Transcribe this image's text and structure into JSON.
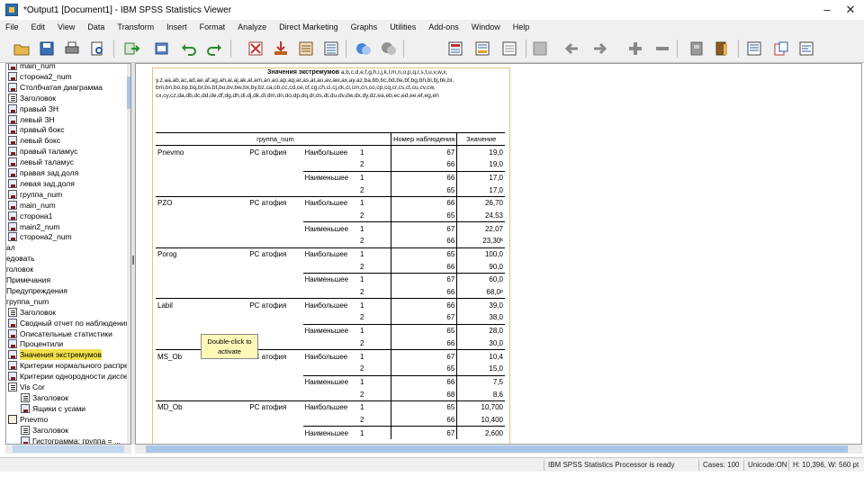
{
  "window": {
    "title": "*Output1 [Document1] - IBM SPSS Statistics Viewer",
    "minimize": "–",
    "close": "✕"
  },
  "menu": [
    "File",
    "Edit",
    "View",
    "Data",
    "Transform",
    "Insert",
    "Format",
    "Analyze",
    "Direct Marketing",
    "Graphs",
    "Utilities",
    "Add-ons",
    "Window",
    "Help"
  ],
  "toolbar_icons": [
    "open-icon",
    "save-icon",
    "print-icon",
    "print-preview-icon",
    "export-icon",
    "recall-dialog-icon",
    "undo-icon",
    "redo-icon",
    "goto-data-icon",
    "goto-case-icon",
    "goto-variable-icon",
    "variables-icon",
    "designate-window-icon",
    "select-last-output-icon",
    "promote-icon",
    "demote-icon",
    "expand-icon",
    "collapse-icon",
    "show-icon",
    "hide-icon",
    "insert-heading-icon",
    "insert-title-icon",
    "insert-text-icon",
    "insert-new-icon"
  ],
  "outline": {
    "rows": [
      {
        "label": "main_num",
        "icon": "table",
        "indent": 1
      },
      {
        "label": "сторона2_num",
        "icon": "table",
        "indent": 1
      },
      {
        "label": "Столбчатая диаграмма",
        "icon": "table",
        "indent": 1
      },
      {
        "label": "Заголовок",
        "icon": "heading",
        "indent": 1
      },
      {
        "label": "правый ЗН",
        "icon": "table",
        "indent": 1
      },
      {
        "label": "левый ЗН",
        "icon": "table",
        "indent": 1
      },
      {
        "label": "правый бокс",
        "icon": "table",
        "indent": 1
      },
      {
        "label": "левый бокс",
        "icon": "table",
        "indent": 1
      },
      {
        "label": "правый таламус",
        "icon": "table",
        "indent": 1
      },
      {
        "label": "левый таламус",
        "icon": "table",
        "indent": 1
      },
      {
        "label": "правая зад.доля",
        "icon": "table",
        "indent": 1
      },
      {
        "label": "левая зад.доля",
        "icon": "table",
        "indent": 1
      },
      {
        "label": "группа_num",
        "icon": "table",
        "indent": 1
      },
      {
        "label": "main_num",
        "icon": "table",
        "indent": 1
      },
      {
        "label": "сторона1",
        "icon": "table",
        "indent": 1
      },
      {
        "label": "main2_num",
        "icon": "table",
        "indent": 1
      },
      {
        "label": "сторона2_num",
        "icon": "table",
        "indent": 1
      },
      {
        "label": "ал",
        "icon": "none",
        "indent": 0
      },
      {
        "label": "едовать",
        "icon": "none",
        "indent": 0
      },
      {
        "label": "головок",
        "icon": "none",
        "indent": 0
      },
      {
        "label": "Примечания",
        "icon": "none",
        "indent": 0
      },
      {
        "label": "Предупреждения",
        "icon": "none",
        "indent": 0
      },
      {
        "label": "группа_num",
        "icon": "none",
        "indent": 0
      },
      {
        "label": "Заголовок",
        "icon": "heading",
        "indent": 1
      },
      {
        "label": "Сводный отчет по наблюдениям",
        "icon": "table",
        "indent": 1
      },
      {
        "label": "Описательные статистики",
        "icon": "table",
        "indent": 1
      },
      {
        "label": "Процентили",
        "icon": "table",
        "indent": 1
      },
      {
        "label": "Значения экстремумов",
        "icon": "table",
        "indent": 1,
        "selected": true
      },
      {
        "label": "Критерии нормального распределения",
        "icon": "table",
        "indent": 1
      },
      {
        "label": "Критерии однородности дисперсий",
        "icon": "table",
        "indent": 1
      },
      {
        "label": "Vis Cor",
        "icon": "heading",
        "indent": 1
      },
      {
        "label": "Заголовок",
        "icon": "heading",
        "indent": 2
      },
      {
        "label": "Ящики с усами",
        "icon": "table",
        "indent": 2
      },
      {
        "label": "Pnevmo",
        "icon": "log",
        "indent": 1
      },
      {
        "label": "Заголовок",
        "icon": "heading",
        "indent": 2
      },
      {
        "label": "Гистограмма: группа = ...",
        "icon": "table",
        "indent": 2
      }
    ]
  },
  "notes": {
    "title": "Значения экстремумов",
    "lines": [
      "a,b,c,d,e,f,g,h,i,j,k,l,m,n,o,p,q,r,s,t,u,v,w,x,",
      "y,z,aa,ab,ac,ad,ae,af,ag,ah,ai,aj,ak,al,am,an,ao,ap,aq,ar,as,at,au,av,aw,ax,ay,az,ba,bb,bc,bd,be,bf,bg,bh,bi,bj,bk,bl,",
      "bm,bn,bo,bp,bq,br,bs,bt,bu,bv,bw,bx,by,bz,ca,cb,cc,cd,ce,cf,cg,ch,ci,cj,ck,cl,cm,cn,co,cp,cq,cr,cs,ct,cu,cv,cw,",
      "cx,cy,cz,da,db,dc,dd,de,df,dg,dh,di,dj,dk,dl,dm,dn,do,dp,dq,dr,ds,dt,du,dv,dw,dx,dy,dz,ea,eb,ec,ed,ee,ef,eg,eh"
    ]
  },
  "table": {
    "header": {
      "group": "группа_num",
      "case": "Номер наблюдения",
      "value": "Значение"
    },
    "rows": [
      {
        "v": "Pnevmo",
        "g": "PC атофия",
        "d": "Наибольшее",
        "n": "1",
        "id": "67",
        "val": "19,0",
        "grp": true
      },
      {
        "v": "",
        "g": "",
        "d": "",
        "n": "2",
        "id": "66",
        "val": "19,0"
      },
      {
        "v": "",
        "g": "",
        "d": "Наименьшее",
        "n": "1",
        "id": "66",
        "val": "17,0",
        "sub": true
      },
      {
        "v": "",
        "g": "",
        "d": "",
        "n": "2",
        "id": "65",
        "val": "17,0"
      },
      {
        "v": "PZO",
        "g": "PC атофия",
        "d": "Наибольшее",
        "n": "1",
        "id": "66",
        "val": "26,70",
        "sub": true
      },
      {
        "v": "",
        "g": "",
        "d": "",
        "n": "2",
        "id": "65",
        "val": "24,53"
      },
      {
        "v": "",
        "g": "",
        "d": "Наименьшее",
        "n": "1",
        "id": "67",
        "val": "22,07",
        "sub": true
      },
      {
        "v": "",
        "g": "",
        "d": "",
        "n": "2",
        "id": "66",
        "val": "23,30ᵏ"
      },
      {
        "v": "Porog",
        "g": "PC атофия",
        "d": "Наибольшее",
        "n": "1",
        "id": "65",
        "val": "100,0",
        "sub": true
      },
      {
        "v": "",
        "g": "",
        "d": "",
        "n": "2",
        "id": "66",
        "val": "90,0"
      },
      {
        "v": "",
        "g": "",
        "d": "Наименьшее",
        "n": "1",
        "id": "67",
        "val": "60,0",
        "sub": true
      },
      {
        "v": "",
        "g": "",
        "d": "",
        "n": "2",
        "id": "66",
        "val": "68,0ᵖ"
      },
      {
        "v": "Labil",
        "g": "PC атофия",
        "d": "Наибольшее",
        "n": "1",
        "id": "66",
        "val": "39,0",
        "sub": true
      },
      {
        "v": "",
        "g": "",
        "d": "",
        "n": "2",
        "id": "67",
        "val": "38,0"
      },
      {
        "v": "",
        "g": "",
        "d": "Наименьшее",
        "n": "1",
        "id": "65",
        "val": "28,0",
        "sub": true
      },
      {
        "v": "",
        "g": "",
        "d": "",
        "n": "2",
        "id": "66",
        "val": "30,0"
      },
      {
        "v": "MS_Ob",
        "g": "PC атофия",
        "d": "Наибольшее",
        "n": "1",
        "id": "67",
        "val": "10,4",
        "sub": true
      },
      {
        "v": "",
        "g": "",
        "d": "",
        "n": "2",
        "id": "65",
        "val": "15,0"
      },
      {
        "v": "",
        "g": "",
        "d": "Наименьшее",
        "n": "1",
        "id": "66",
        "val": "7,5",
        "sub": true
      },
      {
        "v": "",
        "g": "",
        "d": "",
        "n": "2",
        "id": "68",
        "val": "8,6"
      },
      {
        "v": "MD_Ob",
        "g": "PC атофия",
        "d": "Наибольшее",
        "n": "1",
        "id": "65",
        "val": "10,700",
        "sub": true
      },
      {
        "v": "",
        "g": "",
        "d": "",
        "n": "2",
        "id": "66",
        "val": "10,400"
      },
      {
        "v": "",
        "g": "",
        "d": "Наименьшее",
        "n": "1",
        "id": "67",
        "val": "2,600",
        "sub": true
      }
    ]
  },
  "tooltip": {
    "line1": "Double-click to",
    "line2": "activate"
  },
  "status": {
    "processor": "IBM SPSS Statistics Processor is ready",
    "unicode": "Unicode:ON",
    "cases": "Cases: 100",
    "size": "H: 10,396, W: 560 pt"
  }
}
